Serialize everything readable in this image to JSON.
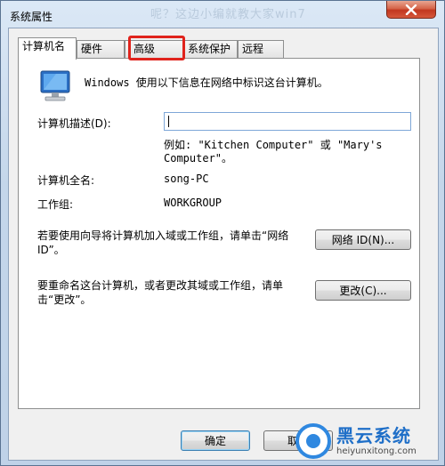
{
  "window": {
    "title": "系统属性",
    "background_title": "呢？这边小编就教大家win7",
    "close_icon": "close-x-icon"
  },
  "tabs": [
    {
      "label": "计算机名",
      "active": true
    },
    {
      "label": "硬件",
      "active": false
    },
    {
      "label": "高级",
      "active": false,
      "highlighted": true
    },
    {
      "label": "系统保护",
      "active": false
    },
    {
      "label": "远程",
      "active": false
    }
  ],
  "panel": {
    "computer_icon": "computer-monitor-icon",
    "intro_text": "Windows 使用以下信息在网络中标识这台计算机。",
    "description_label": "计算机描述(D):",
    "description_value": "",
    "example_text": "例如: \"Kitchen Computer\" 或 \"Mary's Computer\"。",
    "full_name_label": "计算机全名:",
    "full_name_value": "song-PC",
    "workgroup_label": "工作组:",
    "workgroup_value": "WORKGROUP",
    "network_text": "若要使用向导将计算机加入域或工作组，请单击“网络 ID”。",
    "network_button": "网络 ID(N)...",
    "rename_text": "要重命名这台计算机，或者更改其域或工作组，请单击“更改”。",
    "change_button": "更改(C)..."
  },
  "footer": {
    "ok_button": "确定",
    "cancel_button": "取消"
  },
  "watermark": {
    "title": "黑云系统",
    "url": "heiyunxitong.com"
  },
  "colors": {
    "highlight": "#e0231c",
    "close": "#c2371f",
    "watermark": "#1f6fc8"
  }
}
